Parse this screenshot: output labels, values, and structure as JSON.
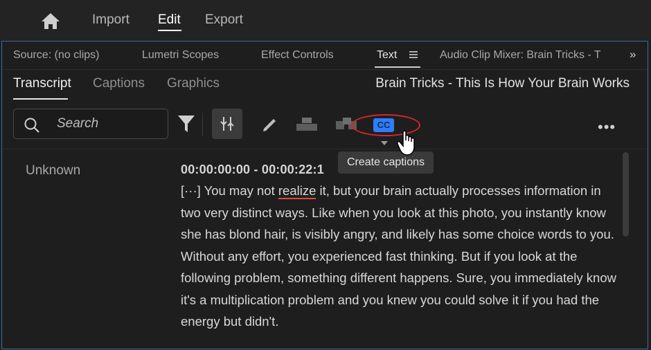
{
  "topbar": {
    "nav": [
      "Import",
      "Edit",
      "Export"
    ],
    "active": "Edit"
  },
  "panel_tabs": {
    "source": "Source: (no clips)",
    "lumetri": "Lumetri Scopes",
    "effect_controls": "Effect Controls",
    "text": "Text",
    "audio_mixer": "Audio Clip Mixer: Brain Tricks - T",
    "overflow": "»"
  },
  "subtabs": {
    "transcript": "Transcript",
    "captions": "Captions",
    "graphics": "Graphics"
  },
  "sequence_title": "Brain Tricks - This Is How Your Brain Works",
  "toolbar": {
    "search_placeholder": "Search",
    "cc_label": "CC",
    "more": "•••",
    "tooltip": "Create captions"
  },
  "transcript": {
    "speaker": "Unknown",
    "timecode": "00:00:00:00 - 00:00:22:1",
    "text_before": "[···] You may not ",
    "underlined_word": "realize",
    "text_after": " it, but your brain actually processes information in two very distinct ways. Like when you look at this photo, you instantly know she has blond hair, is visibly angry, and likely has some choice words to you. Without any effort, you experienced fast thinking. But if you look at the following problem, something different happens. Sure, you immediately know it's a multiplication problem and you knew you could solve it if you had the energy but didn't."
  },
  "colors": {
    "accent_blue": "#2f7df7",
    "highlight_ring": "#d6252c",
    "panel_border": "#3a6ea8"
  },
  "icons": [
    "home-icon",
    "search-icon",
    "filter-icon",
    "split-icon",
    "pencil-icon",
    "merge-icon",
    "insert-icon",
    "cc-icon",
    "more-icon",
    "hand-cursor-icon",
    "hamburger-icon",
    "chevron-double-right-icon"
  ]
}
